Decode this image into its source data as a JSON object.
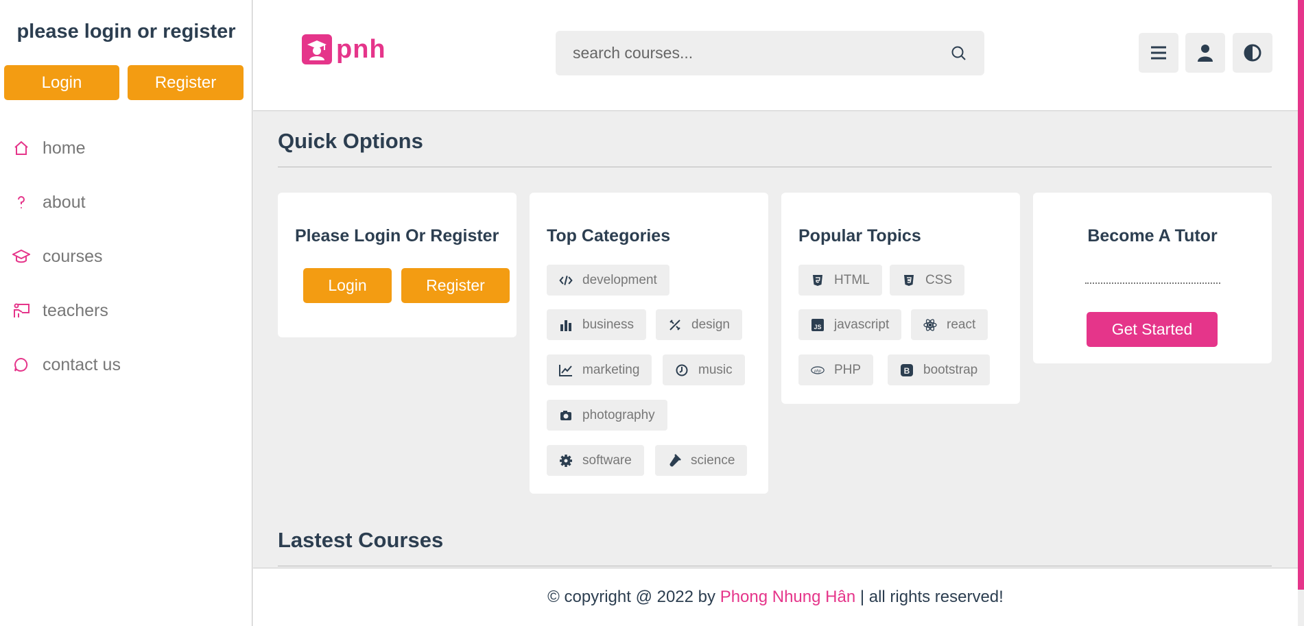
{
  "sidebar": {
    "title": "please login or register",
    "login_label": "Login",
    "register_label": "Register",
    "nav": [
      {
        "label": "home",
        "icon": "home-icon"
      },
      {
        "label": "about",
        "icon": "question-icon"
      },
      {
        "label": "courses",
        "icon": "graduation-cap-icon"
      },
      {
        "label": "teachers",
        "icon": "chalkboard-teacher-icon"
      },
      {
        "label": "contact us",
        "icon": "chat-icon"
      }
    ]
  },
  "header": {
    "logo_text": "pnh",
    "search_placeholder": "search courses...",
    "buttons": [
      "menu-icon",
      "user-icon",
      "theme-toggle-icon"
    ]
  },
  "quick_options": {
    "title": "Quick Options",
    "login_card": {
      "title": "Please Login Or Register",
      "login_label": "Login",
      "register_label": "Register"
    },
    "categories": {
      "title": "Top Categories",
      "items": [
        "development",
        "business",
        "design",
        "marketing",
        "music",
        "photography",
        "software",
        "science"
      ]
    },
    "topics": {
      "title": "Popular Topics",
      "items": [
        "HTML",
        "CSS",
        "javascript",
        "react",
        "PHP",
        "bootstrap"
      ]
    },
    "tutor": {
      "title": "Become A Tutor",
      "button_label": "Get Started"
    }
  },
  "latest_courses": {
    "title": "Lastest Courses"
  },
  "footer": {
    "prefix": "© copyright @ 2022 by ",
    "author": "Phong Nhung Hân",
    "suffix": " | all rights reserved!"
  },
  "colors": {
    "accent": "#e5358a",
    "button": "#f39c12",
    "text": "#2c3e50"
  }
}
